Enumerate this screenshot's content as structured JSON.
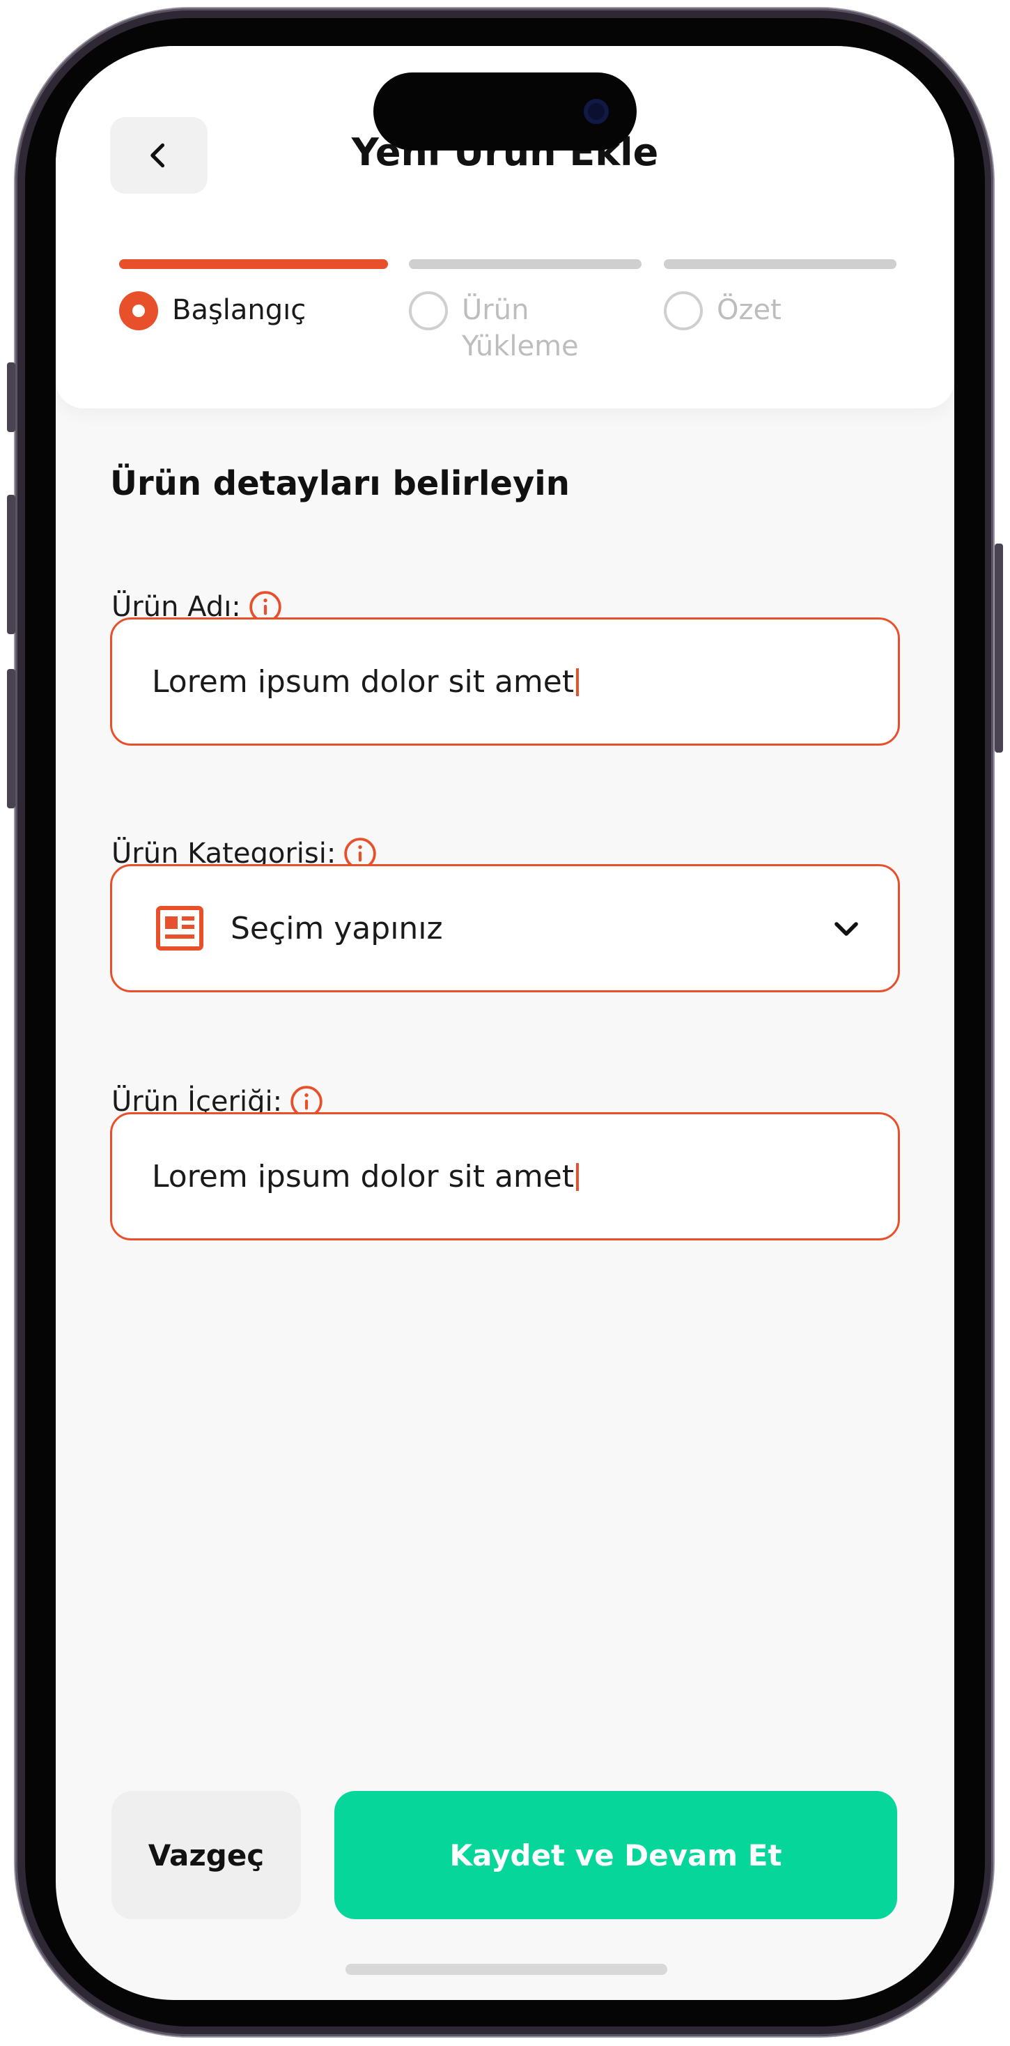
{
  "header": {
    "back_icon": "chevron-left-icon",
    "title": "Yeni Ürün Ekle"
  },
  "stepper": {
    "steps": [
      {
        "label": "Başlangıç",
        "state": "active"
      },
      {
        "label": "Ürün\nYükleme",
        "state": "inactive"
      },
      {
        "label": "Özet",
        "state": "inactive"
      }
    ]
  },
  "form": {
    "section_title": "Ürün detayları belirleyin",
    "product_name": {
      "label": "Ürün Adı:",
      "value": "Lorem ipsum dolor sit amet",
      "info_icon": "info-icon"
    },
    "product_category": {
      "label": "Ürün Kategorisi:",
      "placeholder": "Seçim yapınız",
      "icon": "newspaper-icon",
      "dropdown_icon": "chevron-down-icon",
      "info_icon": "info-icon"
    },
    "product_content": {
      "label": "Ürün İçeriği:",
      "value": "Lorem ipsum dolor sit amet",
      "info_icon": "info-icon"
    }
  },
  "actions": {
    "cancel_label": "Vazgeç",
    "save_label": "Kaydet ve Devam Et"
  },
  "colors": {
    "accent": "#e8502b",
    "primary_button": "#06d69a",
    "inactive": "#cfcfcf",
    "inactive_text": "#bdbdbd"
  }
}
